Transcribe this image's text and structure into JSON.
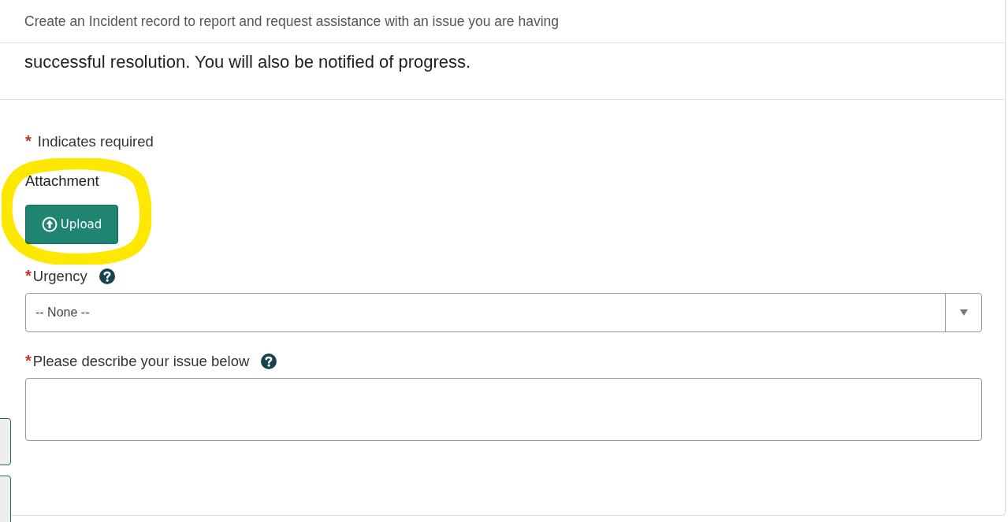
{
  "header": {
    "title": "Create an Incident record to report and request assistance with an issue you are having"
  },
  "description": "successful resolution. You will also be notified of progress.",
  "required_note": {
    "mark": "*",
    "text": "Indicates required"
  },
  "attachment": {
    "label": "Attachment",
    "button": "Upload"
  },
  "fields": [
    {
      "kind": "select",
      "label": "Urgency",
      "required": true,
      "help": true,
      "value": "-- None --"
    },
    {
      "kind": "textarea",
      "label": "Please describe your issue below",
      "required": true,
      "help": true
    }
  ],
  "annotation": {
    "kind": "highlight"
  }
}
